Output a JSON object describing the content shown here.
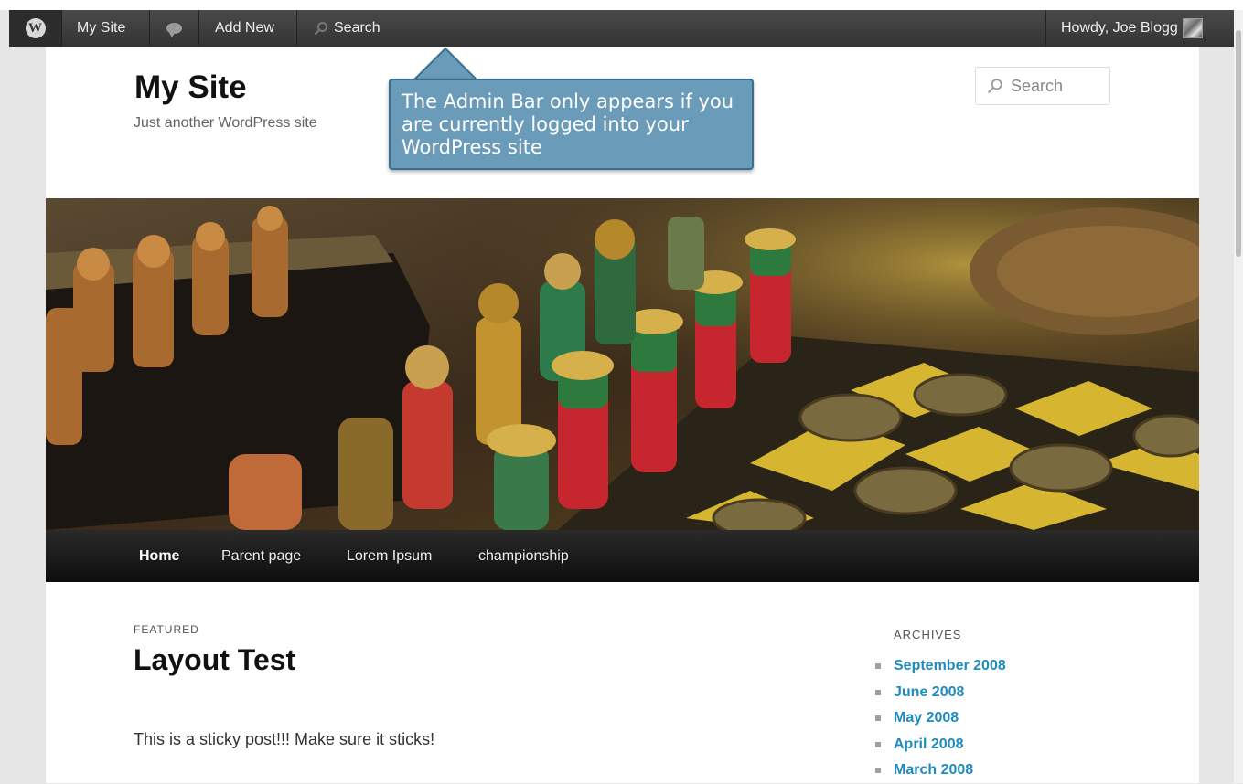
{
  "admin_bar": {
    "wp_logo_icon": "wordpress-logo-icon",
    "my_site": "My Site",
    "comments_icon": "comment-bubble-icon",
    "add_new": "Add New",
    "search": "Search",
    "howdy": "Howdy, Joe Blogg"
  },
  "site": {
    "title": "My Site",
    "tagline": "Just another WordPress site",
    "search_placeholder": "Search"
  },
  "callout": {
    "text": "The Admin Bar only appears if you are currently logged into your WordPress site",
    "color": "#6a9bb8"
  },
  "nav": {
    "items": [
      "Home",
      "Parent page",
      "Lorem Ipsum",
      "championship"
    ]
  },
  "post": {
    "label": "FEATURED",
    "title": "Layout Test",
    "excerpt": "This is a sticky post!!! Make sure it sticks!"
  },
  "sidebar": {
    "archives_title": "ARCHIVES",
    "archives": [
      "September 2008",
      "June 2008",
      "May 2008",
      "April 2008",
      "March 2008"
    ],
    "link_color": "#1e8cbe"
  }
}
